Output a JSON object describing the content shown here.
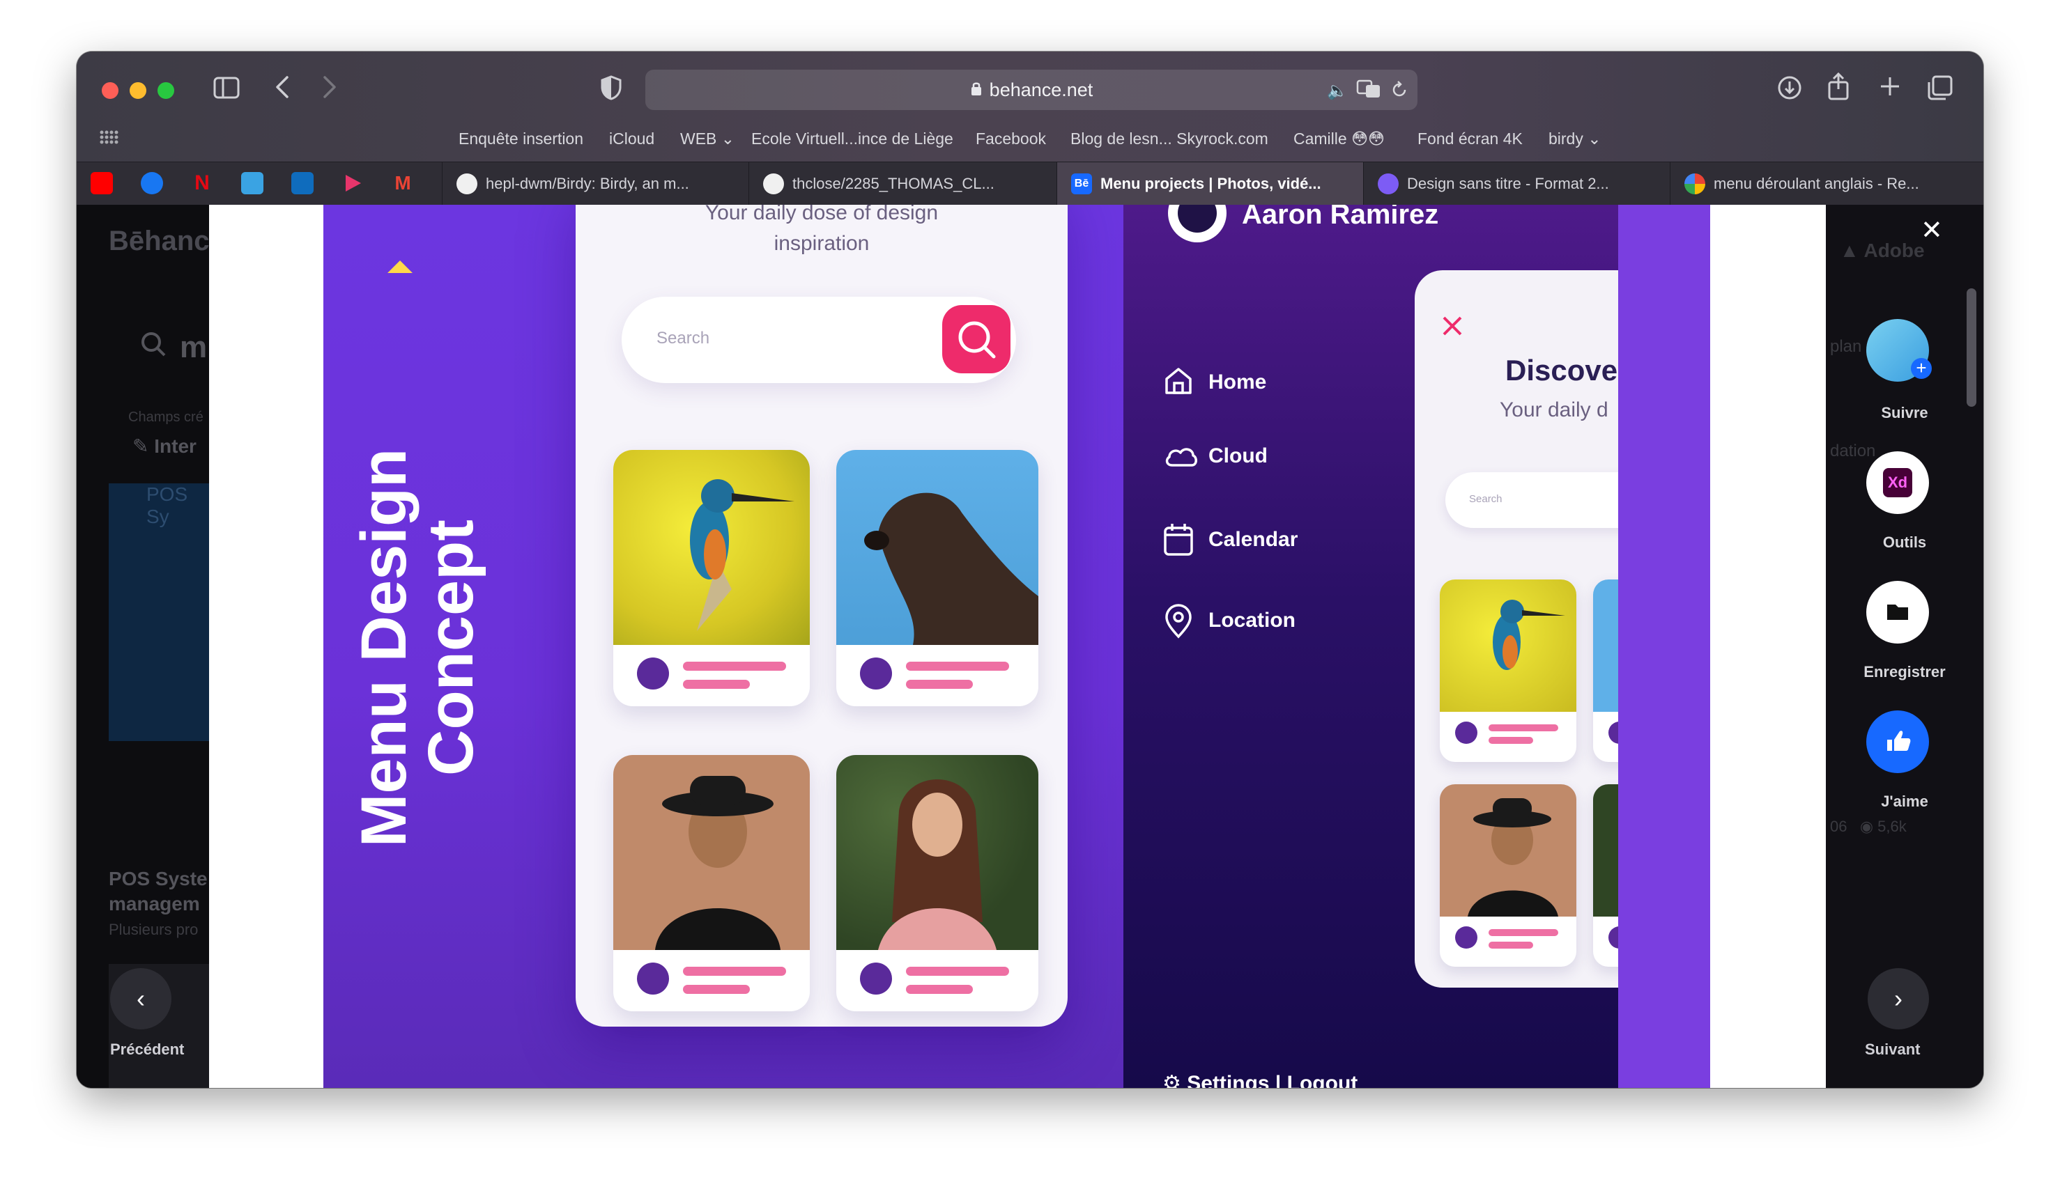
{
  "browser": {
    "url": "behance.net",
    "bookmarks": [
      "Enquête insertion",
      "iCloud",
      "WEB",
      "Ecole Virtuell...ince de Liège",
      "Facebook",
      "Blog de lesn... Skyrock.com",
      "Camille",
      "Fond écran 4K",
      "birdy"
    ],
    "tabs": [
      "hepl-dwm/Birdy: Birdy, an m...",
      "thclose/2285_THOMAS_CL...",
      "Menu projects | Photos, vidé...",
      "Design sans titre - Format 2...",
      "menu déroulant anglais - Re..."
    ],
    "active_tab_index": 2
  },
  "background_page": {
    "logo": "Bēhance",
    "search_partial": "m",
    "field_label_partial": "Champs cré",
    "interest_partial": "Inter",
    "project_title_partial": "POS Syste managem",
    "project_subtitle_partial": "Plusieurs pro",
    "image_caption_partial": "POS Sy",
    "right_partial_1": "plan",
    "right_partial_2": "dation",
    "stats_likes": "06",
    "stats_views": "5,6k",
    "adobe": "Adobe"
  },
  "artboard": {
    "vertical_title": "Menu Design Concept",
    "phone1": {
      "subtitle_line1": "Your daily dose of design",
      "subtitle_line2": "inspiration",
      "search_placeholder": "Search"
    },
    "phone2": {
      "user_name": "Aaron Ramirez",
      "menu_items": [
        "Home",
        "Cloud",
        "Calendar",
        "Location"
      ],
      "footer": "Settings | Logout",
      "discover_title": "Discove",
      "discover_subtitle": "Your daily d",
      "search_placeholder": "Search"
    }
  },
  "actions": {
    "follow": "Suivre",
    "tools": "Outils",
    "save": "Enregistrer",
    "like": "J'aime",
    "previous": "Précédent",
    "next": "Suivant",
    "close": "✕"
  },
  "colors": {
    "accent_purple": "#6c36e0",
    "accent_pink": "#ee2b6b",
    "like_blue": "#1769ff"
  }
}
